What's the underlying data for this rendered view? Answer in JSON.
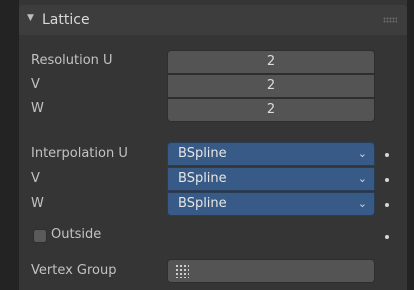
{
  "panel": {
    "title": "Lattice",
    "collapse_glyph": "▼"
  },
  "resolution": {
    "u_label": "Resolution U",
    "v_label": "V",
    "w_label": "W",
    "u_value": "2",
    "v_value": "2",
    "w_value": "2"
  },
  "interpolation": {
    "u_label": "Interpolation U",
    "v_label": "V",
    "w_label": "W",
    "u_value": "BSpline",
    "v_value": "BSpline",
    "w_value": "BSpline",
    "chevron": "⌄"
  },
  "outside": {
    "label": "Outside",
    "checked": false
  },
  "vertex_group": {
    "label": "Vertex Group",
    "value": ""
  },
  "colors": {
    "panel_bg": "#353535",
    "header_bg": "#3d3d3d",
    "field_bg": "#545454",
    "dropdown_bg": "#375a86"
  },
  "icons": [
    "disclosure-triangle-icon",
    "drag-grip-icon",
    "chevron-down-icon",
    "keyframe-dot-icon",
    "vertex-group-icon"
  ]
}
